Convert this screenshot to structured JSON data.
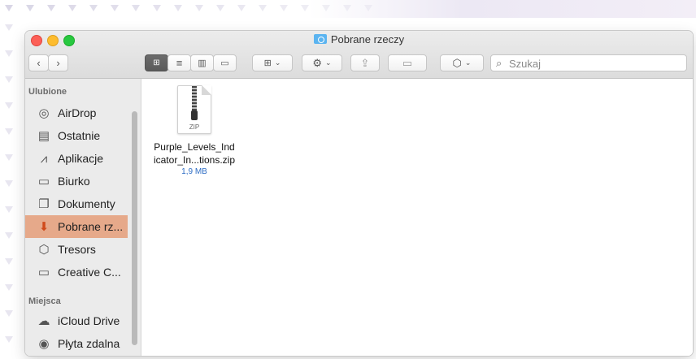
{
  "window": {
    "title": "Pobrane rzeczy"
  },
  "toolbar": {
    "back_icon": "chevron-left-icon",
    "forward_icon": "chevron-right-icon",
    "view_icon_icon": "grid-icon",
    "view_list_icon": "list-icon",
    "view_column_icon": "columns-icon",
    "view_gallery_icon": "gallery-icon",
    "group_icon": "group-grid-icon",
    "action_icon": "gear-icon",
    "share_icon": "share-icon",
    "tag_icon": "tag-icon",
    "dropbox_icon": "dropbox-icon"
  },
  "search": {
    "placeholder": "Szukaj"
  },
  "sidebar": {
    "favorites_header": "Ulubione",
    "places_header": "Miejsca",
    "favorites": [
      {
        "label": "AirDrop",
        "icon": "airdrop-icon"
      },
      {
        "label": "Ostatnie",
        "icon": "recents-icon"
      },
      {
        "label": "Aplikacje",
        "icon": "applications-icon"
      },
      {
        "label": "Biurko",
        "icon": "desktop-icon"
      },
      {
        "label": "Dokumenty",
        "icon": "documents-icon"
      },
      {
        "label": "Pobrane rz...",
        "icon": "downloads-icon",
        "selected": true
      },
      {
        "label": "Tresors",
        "icon": "tresors-icon"
      },
      {
        "label": "Creative C...",
        "icon": "folder-icon"
      }
    ],
    "places": [
      {
        "label": "iCloud Drive",
        "icon": "cloud-icon"
      },
      {
        "label": "Płyta zdalna",
        "icon": "remote-disc-icon"
      }
    ]
  },
  "files": [
    {
      "name_line1": "Purple_Levels_Ind",
      "name_line2": "icator_In...tions.zip",
      "size": "1,9 MB",
      "type_label": "ZIP",
      "icon": "zip-file-icon"
    }
  ],
  "colors": {
    "selection": "#e6a98a",
    "accent": "#d04a1a",
    "size_text": "#2d6cc4"
  }
}
